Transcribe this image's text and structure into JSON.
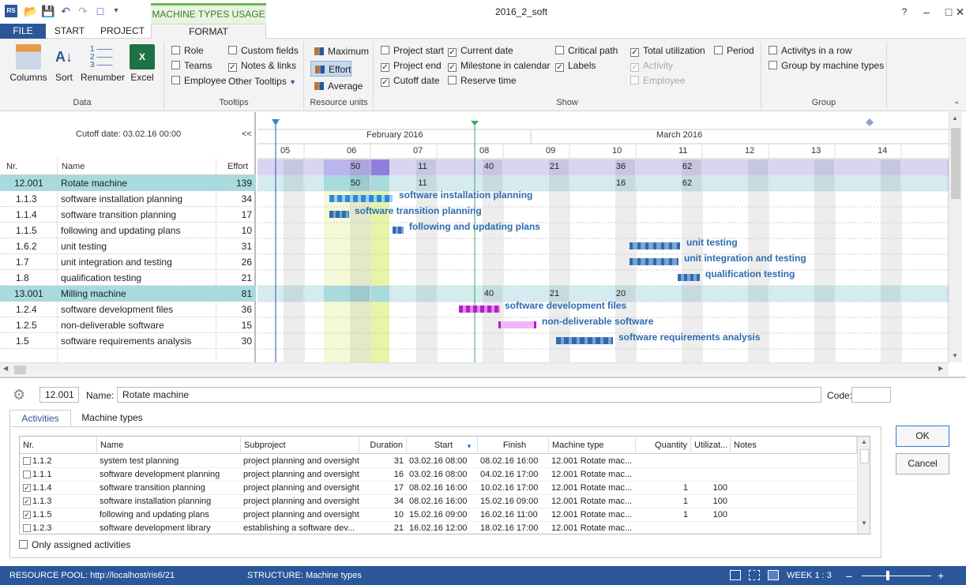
{
  "window": {
    "title": "2016_2_soft",
    "context_tab": "MACHINE TYPES USAGE"
  },
  "tabs": [
    "FILE",
    "START",
    "PROJECT",
    "FORMAT"
  ],
  "ribbon": {
    "data_group": {
      "label": "Data",
      "buttons": [
        "Columns",
        "Sort",
        "Renumber",
        "Excel"
      ]
    },
    "tooltips_group": {
      "label": "Tooltips",
      "checks": [
        {
          "label": "Role",
          "checked": false
        },
        {
          "label": "Teams",
          "checked": false
        },
        {
          "label": "Employee",
          "checked": false
        },
        {
          "label": "Custom fields",
          "checked": false
        },
        {
          "label": "Notes & links",
          "checked": true
        }
      ],
      "other": "Other Tooltips"
    },
    "resource_group": {
      "label": "Resource units",
      "options": [
        "Maximum",
        "Effort",
        "Average"
      ],
      "selected": "Effort"
    },
    "show_group": {
      "label": "Show",
      "checks": [
        {
          "label": "Project start",
          "checked": false
        },
        {
          "label": "Project end",
          "checked": true
        },
        {
          "label": "Cutoff date",
          "checked": true
        },
        {
          "label": "Current date",
          "checked": true
        },
        {
          "label": "Milestone in calendar",
          "checked": true
        },
        {
          "label": "Reserve time",
          "checked": false
        },
        {
          "label": "Critical path",
          "checked": false
        },
        {
          "label": "Labels",
          "checked": true
        },
        {
          "label": "Total utilization",
          "checked": true
        },
        {
          "label": "Activity",
          "checked": true,
          "disabled": true
        },
        {
          "label": "Employee",
          "checked": false,
          "disabled": true
        },
        {
          "label": "Period",
          "checked": false
        }
      ]
    },
    "group_group": {
      "label": "Group",
      "checks": [
        {
          "label": "Activitys in a row",
          "checked": false
        },
        {
          "label": "Group by machine types",
          "checked": false
        }
      ]
    }
  },
  "left": {
    "cutoff": "Cutoff date: 03.02.16 00:00",
    "collapse": "<<",
    "headers": [
      "Nr.",
      "Name",
      "Effort"
    ]
  },
  "rows": [
    {
      "nr": "12.001",
      "name": "Rotate machine",
      "effort": "139",
      "group": true
    },
    {
      "nr": "1.1.3",
      "name": "software installation planning",
      "effort": "34"
    },
    {
      "nr": "1.1.4",
      "name": "software transition planning",
      "effort": "17"
    },
    {
      "nr": "1.1.5",
      "name": "following and updating plans",
      "effort": "10"
    },
    {
      "nr": "1.6.2",
      "name": "unit testing",
      "effort": "31"
    },
    {
      "nr": "1.7",
      "name": "unit integration and testing",
      "effort": "26"
    },
    {
      "nr": "1.8",
      "name": "qualification testing",
      "effort": "21"
    },
    {
      "nr": "13.001",
      "name": "Milling machine",
      "effort": "81",
      "group": true
    },
    {
      "nr": "1.2.4",
      "name": "software development files",
      "effort": "36"
    },
    {
      "nr": "1.2.5",
      "name": "non-deliverable software",
      "effort": "15"
    },
    {
      "nr": "1.5",
      "name": "software requirements analysis",
      "effort": "30"
    }
  ],
  "gantt": {
    "months": [
      "February 2016",
      "March 2016"
    ],
    "weeks": [
      "05",
      "06",
      "07",
      "08",
      "09",
      "10",
      "11",
      "12",
      "13",
      "14"
    ],
    "total_util": [
      "50",
      "11",
      "40",
      "21",
      "36",
      "62"
    ],
    "rotate_util": [
      "50",
      "11",
      "16",
      "62"
    ],
    "milling_util": [
      "40",
      "21",
      "20"
    ],
    "labels": [
      "software installation planning",
      "software transition planning",
      "following and updating plans",
      "unit testing",
      "unit integration and testing",
      "qualification testing",
      "software development files",
      "non-deliverable software",
      "software requirements analysis"
    ]
  },
  "detail": {
    "code": "12.001",
    "name_label": "Name:",
    "name": "Rotate machine",
    "code_label": "Code:",
    "tabs": [
      "Activities",
      "Machine types"
    ],
    "columns": [
      "Nr.",
      "Name",
      "Subproject",
      "Duration",
      "Start",
      "Finish",
      "Machine type",
      "Quantity",
      "Utilizat...",
      "Notes"
    ],
    "rows": [
      {
        "checked": false,
        "nr": "1.1.2",
        "name": "system test planning",
        "sub": "project planning and oversight",
        "dur": "31",
        "start": "03.02.16 08:00",
        "finish": "08.02.16 16:00",
        "mt": "12.001 Rotate mac...",
        "qty": "",
        "util": ""
      },
      {
        "checked": false,
        "nr": "1.1.1",
        "name": "software development planning",
        "sub": "project planning and oversight",
        "dur": "16",
        "start": "03.02.16 08:00",
        "finish": "04.02.16 17:00",
        "mt": "12.001 Rotate mac...",
        "qty": "",
        "util": ""
      },
      {
        "checked": true,
        "nr": "1.1.4",
        "name": "software transition planning",
        "sub": "project planning and oversight",
        "dur": "17",
        "start": "08.02.16 16:00",
        "finish": "10.02.16 17:00",
        "mt": "12.001 Rotate mac...",
        "qty": "1",
        "util": "100"
      },
      {
        "checked": true,
        "nr": "1.1.3",
        "name": "software installation planning",
        "sub": "project planning and oversight",
        "dur": "34",
        "start": "08.02.16 16:00",
        "finish": "15.02.16 09:00",
        "mt": "12.001 Rotate mac...",
        "qty": "1",
        "util": "100"
      },
      {
        "checked": true,
        "nr": "1.1.5",
        "name": "following and updating plans",
        "sub": "project planning and oversight",
        "dur": "10",
        "start": "15.02.16 09:00",
        "finish": "16.02.16 11:00",
        "mt": "12.001 Rotate mac...",
        "qty": "1",
        "util": "100"
      },
      {
        "checked": false,
        "nr": "1.2.3",
        "name": "software development library",
        "sub": "establishing a software dev...",
        "dur": "21",
        "start": "16.02.16 12:00",
        "finish": "18.02.16 17:00",
        "mt": "12.001 Rotate mac...",
        "qty": "",
        "util": ""
      }
    ],
    "only_assigned": "Only assigned activities",
    "ok": "OK",
    "cancel": "Cancel"
  },
  "status": {
    "pool": "RESOURCE POOL: http://localhost/ris6/21",
    "structure": "STRUCTURE: Machine types",
    "zoom": "WEEK 1 : 3"
  }
}
